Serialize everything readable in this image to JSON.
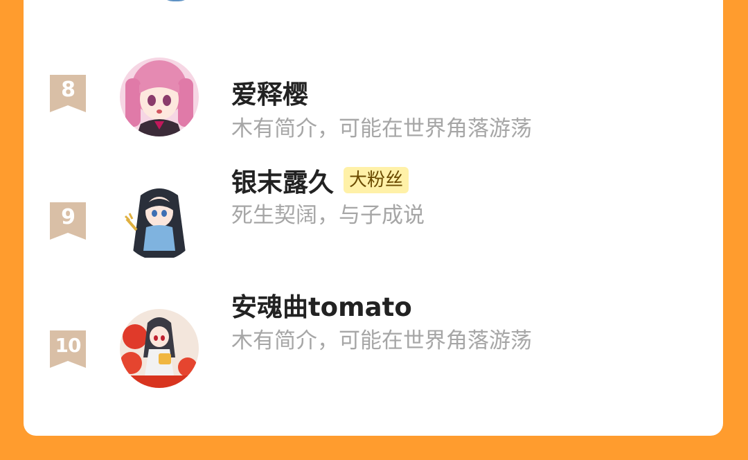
{
  "colors": {
    "background": "#ff9c2e",
    "card": "#ffffff",
    "rank_ribbon": "#d9bfa6",
    "name": "#222222",
    "bio": "#a6a6a6",
    "badge_bg": "#fff1a8",
    "badge_text": "#6b4b00"
  },
  "fans": [
    {
      "rank": "8",
      "name": "爱释樱",
      "badge": "",
      "bio": "木有简介，可能在世界角落游荡",
      "avatar_icon": "anime-girl-pink-hair-avatar"
    },
    {
      "rank": "9",
      "name": "银末露久",
      "badge": "大粉丝",
      "bio": "死生契阔，与子成说",
      "avatar_icon": "anime-girl-dark-hair-avatar"
    },
    {
      "rank": "10",
      "name": "安魂曲tomato",
      "badge": "",
      "bio": "木有简介，可能在世界角落游荡",
      "avatar_icon": "anime-girl-tomato-avatar"
    }
  ]
}
